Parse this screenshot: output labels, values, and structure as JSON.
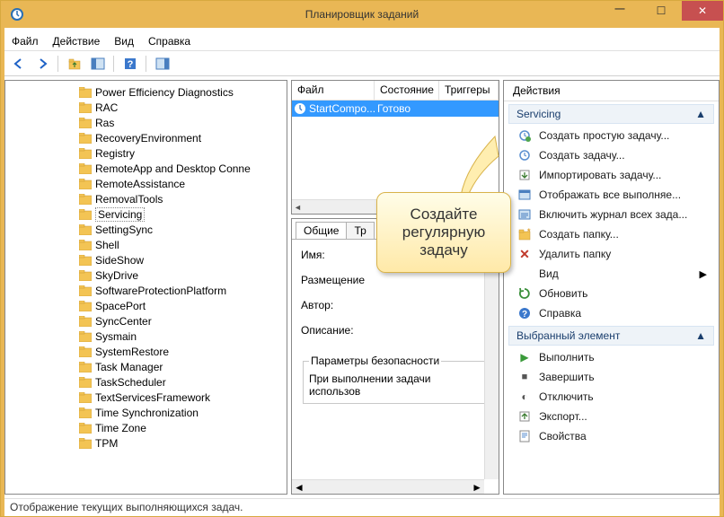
{
  "window": {
    "title": "Планировщик заданий"
  },
  "menu": {
    "file": "Файл",
    "action": "Действие",
    "view": "Вид",
    "help": "Справка"
  },
  "tree": {
    "items": [
      "Power Efficiency Diagnostics",
      "RAC",
      "Ras",
      "RecoveryEnvironment",
      "Registry",
      "RemoteApp and Desktop Conne",
      "RemoteAssistance",
      "RemovalTools",
      "Servicing",
      "SettingSync",
      "Shell",
      "SideShow",
      "SkyDrive",
      "SoftwareProtectionPlatform",
      "SpacePort",
      "SyncCenter",
      "Sysmain",
      "SystemRestore",
      "Task Manager",
      "TaskScheduler",
      "TextServicesFramework",
      "Time Synchronization",
      "Time Zone",
      "TPM"
    ],
    "selected_index": 8
  },
  "tasklist": {
    "columns": {
      "file": "Файл",
      "state": "Состояние",
      "triggers": "Триггеры"
    },
    "row": {
      "name": "StartCompo...",
      "state": "Готово"
    }
  },
  "details": {
    "tabs": {
      "general": "Общие",
      "triggers_short": "Тр"
    },
    "labels": {
      "name": "Имя:",
      "location": "Размещение",
      "author": "Автор:",
      "description": "Описание:"
    },
    "security_group": "Параметры безопасности",
    "security_line": "При выполнении задачи использов"
  },
  "actions": {
    "title": "Действия",
    "group1": "Servicing",
    "items1": [
      "Создать простую задачу...",
      "Создать задачу...",
      "Импортировать задачу...",
      "Отображать все выполняе...",
      "Включить журнал всех зада...",
      "Создать папку...",
      "Удалить папку",
      "Вид",
      "Обновить",
      "Справка"
    ],
    "group2": "Выбранный элемент",
    "items2": [
      "Выполнить",
      "Завершить",
      "Отключить",
      "Экспорт...",
      "Свойства"
    ]
  },
  "callout": {
    "line1": "Создайте",
    "line2": "регулярную",
    "line3": "задачу"
  },
  "status": "Отображение текущих выполняющихся задач."
}
